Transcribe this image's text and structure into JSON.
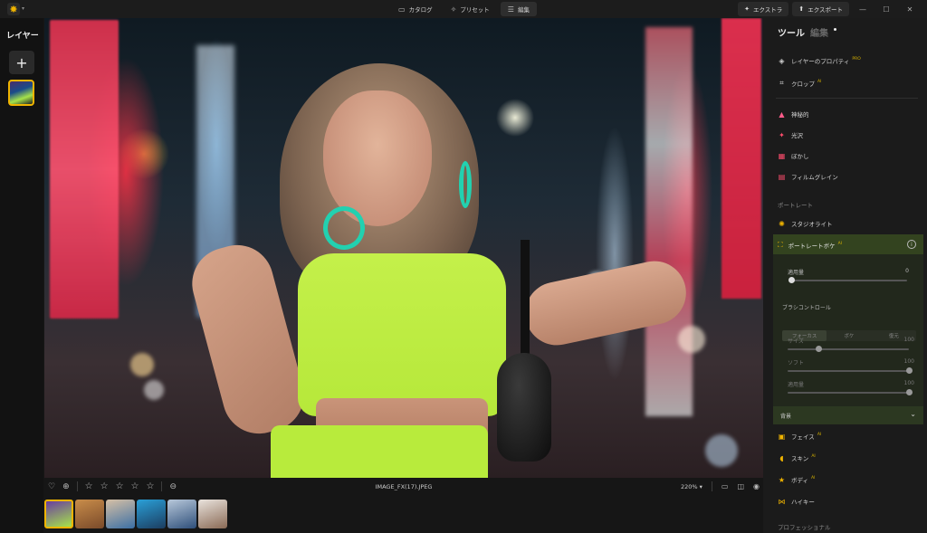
{
  "topbar": {
    "modes": [
      {
        "icon": "folder-icon",
        "glyph": "▭",
        "label": "カタログ"
      },
      {
        "icon": "preset-icon",
        "glyph": "✧",
        "label": "プリセット"
      },
      {
        "icon": "edit-icon",
        "glyph": "☰",
        "label": "編集"
      }
    ],
    "extras_label": "エクストラ",
    "export_label": "エクスポート"
  },
  "left_panel": {
    "title": "レイヤー"
  },
  "bottom_bar": {
    "filename": "IMAGE_FX(17).JPEG",
    "zoom": "220%",
    "rating_stars": 5
  },
  "filmstrip": [
    {
      "selected": true,
      "colors": [
        "#6a3da0",
        "#a6e34a"
      ]
    },
    {
      "selected": false,
      "colors": [
        "#c98d4a",
        "#7a4a2a"
      ]
    },
    {
      "selected": false,
      "colors": [
        "#d7c0a5",
        "#3b6fa5"
      ]
    },
    {
      "selected": false,
      "colors": [
        "#2aa0d8",
        "#1c3d60"
      ]
    },
    {
      "selected": false,
      "colors": [
        "#b8c8da",
        "#2e4f7a"
      ]
    },
    {
      "selected": false,
      "colors": [
        "#e9e3dd",
        "#8a6a55"
      ]
    }
  ],
  "right_panel": {
    "tabs": [
      "ツール",
      "編集"
    ],
    "items_top": [
      {
        "icon": "layer-properties-icon",
        "glyph": "◈",
        "label": "レイヤーのプロパティ",
        "badge": "PRO",
        "color": "#cfcfcf"
      },
      {
        "icon": "crop-icon",
        "glyph": "⌗",
        "label": "クロップ",
        "badge": "AI",
        "color": "#cfcfcf"
      }
    ],
    "items_effects": [
      {
        "icon": "mystical-icon",
        "glyph": "▲",
        "label": "神秘的",
        "color": "#ff5c8a"
      },
      {
        "icon": "glow-icon",
        "glyph": "✦",
        "label": "光沢",
        "color": "#ff4d6d"
      },
      {
        "icon": "blur-icon",
        "glyph": "▦",
        "label": "ぼかし",
        "color": "#ff4d6d"
      },
      {
        "icon": "film-grain-icon",
        "glyph": "▤",
        "label": "フィルムグレイン",
        "color": "#ff4d6d"
      }
    ],
    "portrait_section": "ポートレート",
    "studio_light": {
      "icon": "studio-light-icon",
      "glyph": "✺",
      "label": "スタジオライト",
      "color": "#f0b400"
    },
    "portrait_bokeh": {
      "label": "ポートレートボケ",
      "badge": "AI",
      "amount_label": "適用量",
      "amount_value": "0",
      "amount_fraction": 0.0,
      "brush_title": "ブラシコントロール",
      "brush_modes": [
        "フォーカス",
        "ボケ",
        "復元"
      ],
      "size_label": "サイズ",
      "size_value": "100",
      "size_fraction": 0.25,
      "soft_label": "ソフト",
      "soft_value": "100",
      "soft_fraction": 1.0,
      "brush_amount_label": "適用量",
      "brush_amount_value": "100",
      "brush_amount_fraction": 1.0,
      "background_label": "背景"
    },
    "items_portrait": [
      {
        "icon": "face-icon",
        "glyph": "▣",
        "label": "フェイス",
        "badge": "AI",
        "color": "#f0b400"
      },
      {
        "icon": "skin-icon",
        "glyph": "◖",
        "label": "スキン",
        "badge": "AI",
        "color": "#f0b400"
      },
      {
        "icon": "body-icon",
        "glyph": "★",
        "label": "ボディ",
        "badge": "AI",
        "color": "#f0b400"
      },
      {
        "icon": "high-key-icon",
        "glyph": "⋈",
        "label": "ハイキー",
        "badge": "",
        "color": "#f0b400"
      }
    ],
    "professional_section": "プロフェッショナル"
  }
}
